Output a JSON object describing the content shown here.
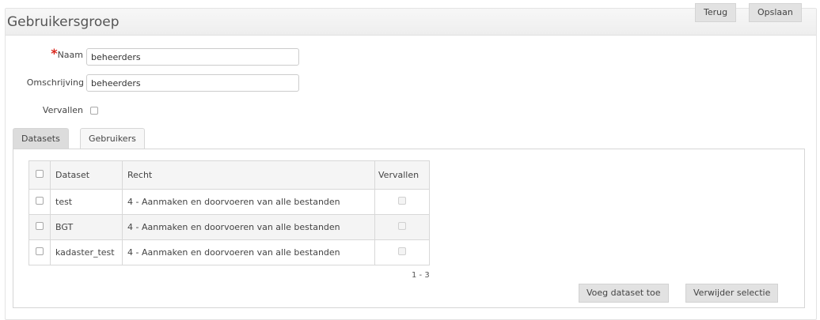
{
  "header": {
    "title": "Gebruikersgroep",
    "back_label": "Terug",
    "save_label": "Opslaan"
  },
  "form": {
    "naam_label": "Naam",
    "naam_required": "*",
    "naam_value": "beheerders",
    "omschrijving_label": "Omschrijving",
    "omschrijving_value": "beheerders",
    "vervallen_label": "Vervallen",
    "vervallen_checked": false
  },
  "tabs": [
    {
      "label": "Datasets",
      "active": true
    },
    {
      "label": "Gebruikers",
      "active": false
    }
  ],
  "grid": {
    "columns": [
      "Dataset",
      "Recht",
      "Vervallen"
    ],
    "rows": [
      {
        "dataset": "test",
        "recht": "4 - Aanmaken en doorvoeren van alle bestanden",
        "vervallen": false
      },
      {
        "dataset": "BGT",
        "recht": "4 - Aanmaken en doorvoeren van alle bestanden",
        "vervallen": false
      },
      {
        "dataset": "kadaster_test",
        "recht": "4 - Aanmaken en doorvoeren van alle bestanden",
        "vervallen": false
      }
    ],
    "pager": "1 - 3"
  },
  "actions": {
    "add_label": "Voeg dataset toe",
    "delete_label": "Verwijder selectie"
  }
}
